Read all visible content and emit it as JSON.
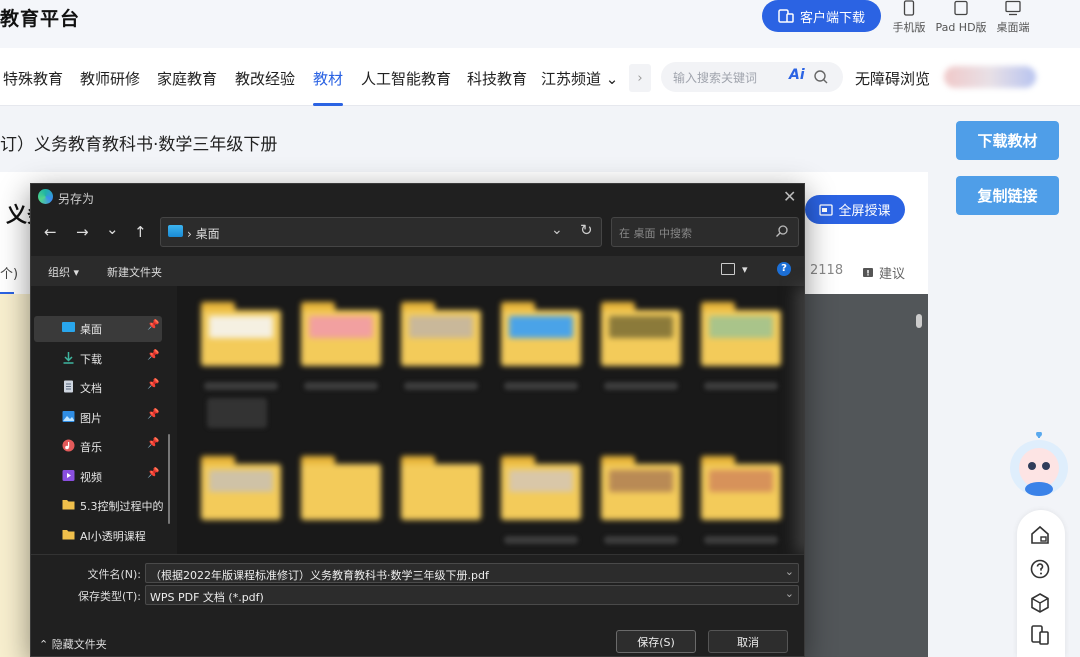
{
  "header": {
    "brand": "教育平台",
    "client_download": "客户端下载",
    "devices": [
      {
        "label": "手机版",
        "icon": "phone-icon"
      },
      {
        "label": "Pad HD版",
        "icon": "tablet-icon"
      },
      {
        "label": "桌面端",
        "icon": "desktop-icon"
      }
    ]
  },
  "nav": {
    "items": [
      "特殊教育",
      "教师研修",
      "家庭教育",
      "教改经验",
      "教材",
      "人工智能教育",
      "科技教育",
      "江苏频道 ⌄"
    ],
    "active": "教材",
    "more_arrow": "›",
    "search_placeholder": "输入搜索关键词",
    "ai_label": "Ai",
    "accessibility": "无障碍浏览"
  },
  "page": {
    "book_title": "订）义务教育教科书·数学三年级下册",
    "card_title": "义务",
    "download_button": "下载教材",
    "copy_link_button": "复制链接",
    "fullscreen_button": "全屏授课",
    "count_left": "个)",
    "count_right": "2118",
    "suggest": "建议"
  },
  "dialog": {
    "title": "另存为",
    "close": "✕",
    "nav_buttons": [
      "←",
      "→",
      "⌄",
      "↑"
    ],
    "address": "› 桌面",
    "address_dropdown": "⌄",
    "refresh": "↻",
    "search_placeholder": "在 桌面 中搜索",
    "toolbar": {
      "organize": "组织 ▾",
      "new_folder": "新建文件夹",
      "view_dropdown": "▾",
      "help": "?"
    },
    "tree": [
      {
        "label": "桌面",
        "icon": "desktop-folder-icon",
        "pinned": true,
        "selected": true
      },
      {
        "label": "下载",
        "icon": "download-icon",
        "pinned": true
      },
      {
        "label": "文档",
        "icon": "document-icon",
        "pinned": true
      },
      {
        "label": "图片",
        "icon": "picture-icon",
        "pinned": true
      },
      {
        "label": "音乐",
        "icon": "music-icon",
        "pinned": true
      },
      {
        "label": "视频",
        "icon": "video-icon",
        "pinned": true
      },
      {
        "label": "5.3控制过程中的",
        "icon": "folder-icon",
        "pinned": false
      },
      {
        "label": "AI小透明课程",
        "icon": "folder-icon",
        "pinned": false
      }
    ],
    "pin_glyph": "📌",
    "filename_label": "文件名(N):",
    "filename_value": "（根据2022年版课程标准修订）义务教育教科书·数学三年级下册.pdf",
    "filetype_label": "保存类型(T):",
    "filetype_value": "WPS PDF 文档 (*.pdf)",
    "dropdown_glyph": "⌄",
    "hide_folders": "⌃ 隐藏文件夹",
    "save_button": "保存(S)",
    "cancel_button": "取消"
  },
  "colors": {
    "brand_blue": "#2b63e3",
    "side_button": "#4f9ee8",
    "dialog_bg": "#202020",
    "folder": "#f3cb5a"
  }
}
